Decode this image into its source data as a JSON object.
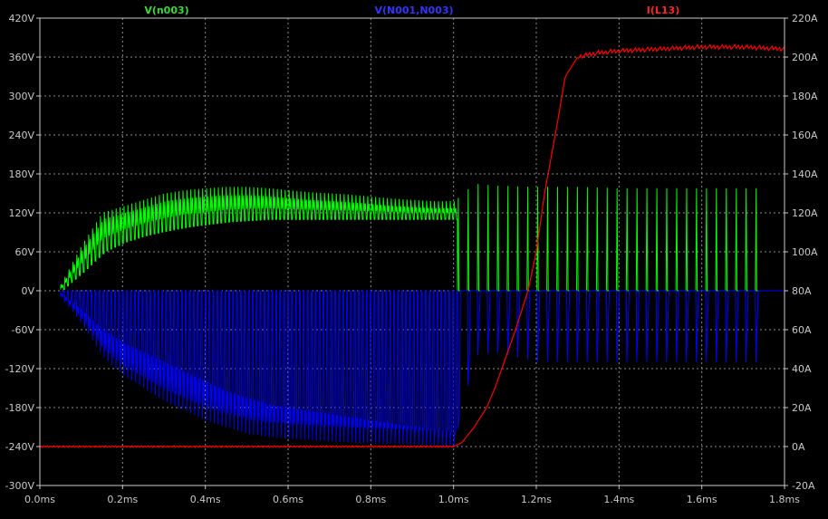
{
  "colors": {
    "background": "#000000",
    "grid": "#8c8c8c",
    "axis_text": "#c8c8c8",
    "green": "#00ff00",
    "blue": "#0000ff",
    "red": "#ff0000",
    "green_label": "#33dd33",
    "blue_label": "#3333ff",
    "red_label": "#ff2222"
  },
  "chart_data": {
    "type": "line",
    "title": "",
    "xlabel": "",
    "ylabel_left": "",
    "ylabel_right": "",
    "grid": true,
    "xlim": [
      0,
      1.8
    ],
    "ylim_left": [
      -300,
      420
    ],
    "ylim_right": [
      -20,
      220
    ],
    "x_ticks": [
      "0.0ms",
      "0.2ms",
      "0.4ms",
      "0.6ms",
      "0.8ms",
      "1.0ms",
      "1.2ms",
      "1.4ms",
      "1.6ms",
      "1.8ms"
    ],
    "y_left_ticks": [
      "420V",
      "360V",
      "300V",
      "240V",
      "180V",
      "120V",
      "60V",
      "0V",
      "-60V",
      "-120V",
      "-180V",
      "-240V",
      "-300V"
    ],
    "y_right_ticks": [
      "220A",
      "200A",
      "180A",
      "160A",
      "140A",
      "120A",
      "100A",
      "80A",
      "60A",
      "40A",
      "20A",
      "0A",
      "-20A"
    ],
    "series": [
      {
        "name": "V(n003)",
        "axis": "left",
        "color": "#00ff00",
        "x": [
          0.05,
          0.1,
          0.15,
          0.2,
          0.25,
          0.3,
          0.35,
          0.4,
          0.45,
          0.5,
          0.55,
          0.6,
          0.65,
          0.7,
          0.75,
          0.8,
          0.85,
          0.9,
          0.95,
          1.0,
          1.05,
          1.1,
          1.2,
          1.3,
          1.4,
          1.5,
          1.6,
          1.7,
          1.75
        ],
        "peak_values": [
          10,
          70,
          120,
          130,
          140,
          150,
          155,
          158,
          160,
          160,
          158,
          155,
          152,
          150,
          148,
          145,
          142,
          140,
          138,
          138,
          165,
          162,
          160,
          160,
          158,
          158,
          158,
          158,
          158
        ],
        "baseline_values": [
          2,
          30,
          60,
          75,
          85,
          92,
          98,
          102,
          106,
          108,
          110,
          110,
          110,
          110,
          110,
          110,
          110,
          110,
          110,
          110,
          5,
          5,
          5,
          5,
          5,
          5,
          5,
          5,
          5
        ]
      },
      {
        "name": "V(N001,N003)",
        "axis": "left",
        "color": "#0000ff",
        "x": [
          0.05,
          0.1,
          0.15,
          0.2,
          0.25,
          0.3,
          0.35,
          0.4,
          0.45,
          0.5,
          0.55,
          0.6,
          0.65,
          0.7,
          0.75,
          0.8,
          0.85,
          0.9,
          0.95,
          1.0,
          1.05,
          1.1,
          1.2,
          1.3,
          1.4,
          1.5,
          1.6,
          1.7,
          1.75
        ],
        "trough_values": [
          -10,
          -50,
          -100,
          -130,
          -150,
          -170,
          -185,
          -200,
          -210,
          -220,
          -225,
          -228,
          -230,
          -232,
          -234,
          -235,
          -236,
          -237,
          -238,
          -240,
          -100,
          -95,
          -110,
          -110,
          -110,
          -110,
          -110,
          -110,
          -110
        ],
        "envelope_values": [
          -5,
          -30,
          -60,
          -80,
          -95,
          -110,
          -125,
          -140,
          -155,
          -165,
          -175,
          -180,
          -185,
          -190,
          -195,
          -200,
          -205,
          -210,
          -215,
          -220,
          -40,
          -40,
          -40,
          -40,
          -40,
          -40,
          -40,
          -40,
          -40
        ]
      },
      {
        "name": "I(L13)",
        "axis": "right",
        "color": "#ff0000",
        "x": [
          0.0,
          0.2,
          0.4,
          0.6,
          0.8,
          1.0,
          1.02,
          1.05,
          1.08,
          1.1,
          1.12,
          1.15,
          1.18,
          1.2,
          1.22,
          1.25,
          1.27,
          1.3,
          1.35,
          1.4,
          1.5,
          1.6,
          1.7,
          1.8
        ],
        "values": [
          0,
          0,
          0,
          0,
          0,
          0,
          2,
          10,
          20,
          30,
          42,
          60,
          80,
          100,
          130,
          165,
          190,
          200,
          202,
          203,
          204,
          205,
          205,
          204
        ]
      }
    ]
  }
}
